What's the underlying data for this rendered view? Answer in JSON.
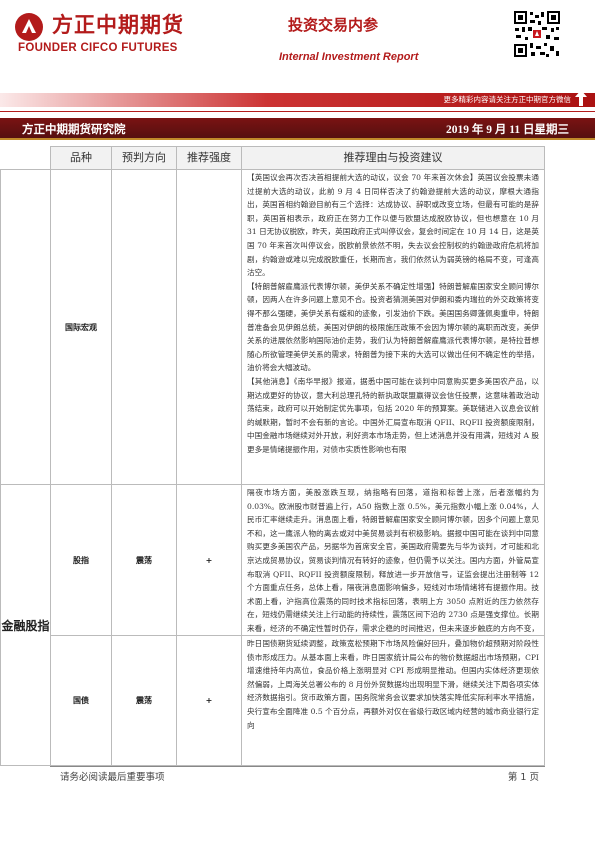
{
  "header": {
    "logo_cn": "方正中期期货",
    "logo_en": "FOUNDER CIFCO FUTURES",
    "report_title": "投资交易内参",
    "report_subtitle": "Internal Investment Report",
    "follow_text": "更多精彩内容请关注方正中期官方微信"
  },
  "dept_bar": {
    "department": "方正中期期货研究院",
    "date": "2019 年 9 月 11 日星期三"
  },
  "table": {
    "headers": [
      "品种",
      "预判方向",
      "推荐强度",
      "推荐理由与投资建议"
    ],
    "sections": [
      {
        "sector": "",
        "label": "国际宏观",
        "direction": "",
        "strength": "",
        "paragraphs": [
          "【英国议会再次否决首相提前大选的动议，议会 70 年来首次休会】英国议会投票未通过提前大选的动议，此前 9 月 4 日同样否决了约翰逊提前大选的动议，摩根大通指出，英国首相约翰逊目前有三个选择：达成协议、辞职或改变立场，但最有可能的是辞职，英国首相表示，政府正在努力工作以便与欧盟达成脱欧协议，但也想意在 10 月 31 日无协议脱欧，昨天，英国政府正式叫停议会，复会时间定在 10 月 14 日，这是英国 70 年来首次叫停议会，脱欧前景依然不明，失去议会控制权的约翰逊政府危机将加剧，约翰逊或难以完成脱欧重任，长期而言，我们依然认为弱英镑的格局不变，可逢高沽空。",
          "【特朗普解雇鹰派代表博尔顿，美伊关系不确定性增强】特朗普解雇国家安全顾问博尔顿，因两人在许多问题上意见不合。投资者猜测美国对伊朗和委内瑞拉的外交政策将变得不那么强硬，美伊关系有缓和的迹象，引发油价下跌。美国国务卿蓬佩奥重申，特朗普准备会见伊朗总统，美国对伊朗的极限施压政策不会因为博尔顿的离职而改变，美伊关系的进展依然影响国际油价走势，我们认为特朗普解雇鹰派代表博尔顿，是特拉普想随心所欲管理美伊关系的需求，特朗普为接下来的大选可以做出任何不确定性的举措，油价将会大幅波动。",
          "【其他消息】《南华早报》报道，据悉中国可能在谈判中同意购买更多美国农产品，以期达成更好的协议，意大利总理孔特的新执政联盟赢得议会信任投票，这意味着政治动荡结束，政府可以开始制定优先事项，包括 2020 年的预算案。美联储进入议息会议前的缄默期，暂时不会有新的言论。中国外汇局宣布取消 QFII、RQFII 投资额度限制，中国金融市场继续对外开放，利好资本市场走势，但上述消息并没有用满，短线对 A 股更多是情绪提振作用，对债市实质性影响也有限"
        ]
      },
      {
        "sector": "金融股指",
        "label": "股指",
        "direction": "震荡",
        "strength": "+",
        "paragraphs": [
          "隔夜市场方面，美股涨跌互现，纳指略有回落，道指和标普上涨，后者涨幅约为 0.03%。欧洲股市财普遍上行，A50 指数上涨 0.5%，美元指数小幅上涨 0.04%，人民币汇率继续走升。消息面上看，特朗普解雇国家安全顾问博尔顿，因多个问题上意见不和，这一鹰派人物的离去或对中美贸易谈判有积极影响。据报中国可能在谈判中同意购买更多美国农产品，另据华为首席安全官，美国政府需要先与华为谈判，才可能和北京达成贸易协议，贸易谈判情况有转好的迹象，但仍需予以关注。国内方面，外管局宣布取消 QFII、RQFII 投资额度限制，释放进一步开放信号，证监会提出注册制等 12 个方面重点任务，总体上看，隔夜消息面影响偏多，短线对市场情绪将有提振作用。技术面上看，沪指高位震荡的同时技术指标回落，表明上方 3050 点附近的压力依然存在，短线仍需继续关注上行动能的持续性，震荡区间下沿的 2730 点是强支撑位。长期来看，经济的不确定性暂时仍存，需求企稳的时间推迟，但未来逐步触底的方向不变，刺激政策正在加码，宽松预期带来的阶段性行情仍值得期待，长期方向等待基本面明确后将会确立。"
        ]
      },
      {
        "sector": "",
        "label": "国债",
        "direction": "震荡",
        "strength": "+",
        "paragraphs": [
          "昨日国债期货延续调整，政策宽松预期下市场风险偏好回升，叠加物价超预期对阶段性债市形成压力。从基本面上来看，昨日国家统计局公布的物价数据超出市场预期，CPI 增速维持年内高位，食品价格上涨明显对 CPI 形成明显推动。但国内实体经济更现依然偏弱，上周海关总署公布的 8 月份外贸数据均出现明显下滑，继续关注下周各项实体经济数据指引。货币政策方面，国务院常务会议要求加快落实降低实际利率水平措施，央行宣布全面降准 0.5 个百分点，再额外对仅在省级行政区域内经营的城市商业银行定向"
        ]
      }
    ]
  },
  "footer": {
    "notice": "请务必阅读最后重要事项",
    "page": "第 1 页"
  }
}
